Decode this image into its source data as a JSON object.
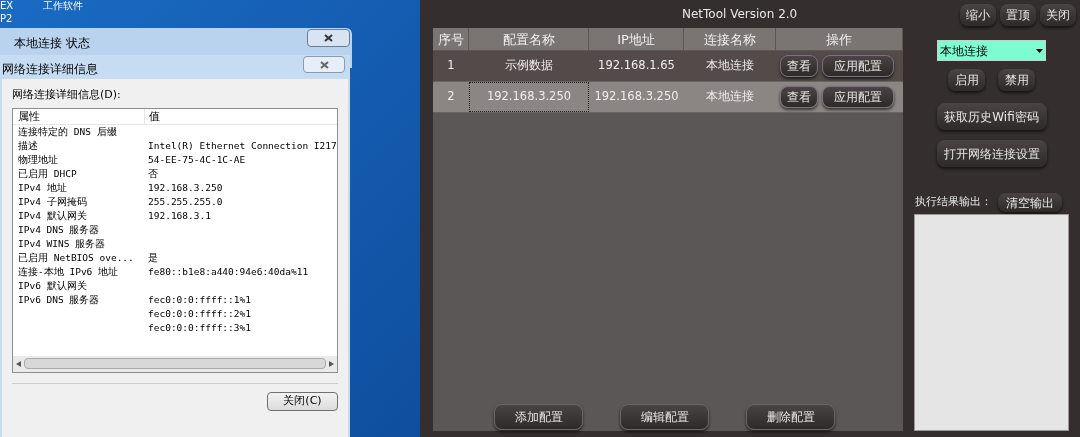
{
  "desktop": {
    "icon_labels": [
      "EX",
      "工作软件",
      "P2"
    ]
  },
  "status_dialog": {
    "title": "本地连接 状态"
  },
  "details_dialog": {
    "title": "网络连接详细信息",
    "list_label": "网络连接详细信息(D):",
    "columns": [
      "属性",
      "值"
    ],
    "rows": [
      {
        "property": "连接特定的 DNS 后缀",
        "value": ""
      },
      {
        "property": "描述",
        "value": "Intel(R) Ethernet Connection I217"
      },
      {
        "property": "物理地址",
        "value": "54-EE-75-4C-1C-AE"
      },
      {
        "property": "已启用 DHCP",
        "value": "否"
      },
      {
        "property": "IPv4 地址",
        "value": "192.168.3.250"
      },
      {
        "property": "IPv4 子网掩码",
        "value": "255.255.255.0"
      },
      {
        "property": "IPv4 默认网关",
        "value": "192.168.3.1"
      },
      {
        "property": "IPv4 DNS 服务器",
        "value": ""
      },
      {
        "property": "IPv4 WINS 服务器",
        "value": ""
      },
      {
        "property": "已启用 NetBIOS ove...",
        "value": "是"
      },
      {
        "property": "连接-本地 IPv6 地址",
        "value": "fe80::b1e8:a440:94e6:40da%11"
      },
      {
        "property": "IPv6 默认网关",
        "value": ""
      },
      {
        "property": "IPv6 DNS 服务器",
        "value": "fec0:0:0:ffff::1%1"
      },
      {
        "property": "",
        "value": "fec0:0:0:ffff::2%1"
      },
      {
        "property": "",
        "value": "fec0:0:0:ffff::3%1"
      }
    ],
    "close_button": "关闭(C)"
  },
  "app": {
    "title": "NetTool Version 2.0",
    "window_buttons": [
      "缩小",
      "置顶",
      "关闭"
    ],
    "table": {
      "columns": [
        "序号",
        "配置名称",
        "IP地址",
        "连接名称",
        "操作"
      ],
      "rows": [
        {
          "index": "1",
          "name": "示例数据",
          "ip": "192.168.1.65",
          "connection": "本地连接",
          "actions": [
            "查看",
            "应用配置"
          ],
          "selected": false
        },
        {
          "index": "2",
          "name": "192.168.3.250",
          "ip": "192.168.3.250",
          "connection": "本地连接",
          "actions": [
            "查看",
            "应用配置"
          ],
          "selected": true
        }
      ]
    },
    "bottom_buttons": [
      "添加配置",
      "编辑配置",
      "删除配置"
    ],
    "connection_select": {
      "value": "本地连接"
    },
    "toggle_buttons": [
      "启用",
      "禁用"
    ],
    "side_buttons": [
      "获取历史Wifi密码",
      "打开网络连接设置"
    ],
    "output_label": "执行结果输出：",
    "clear_button": "清空输出"
  }
}
